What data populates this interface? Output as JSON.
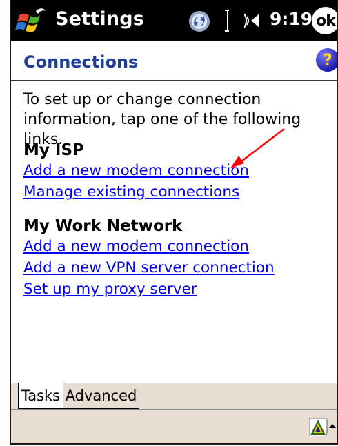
{
  "titlebar": {
    "title": "Settings",
    "clock": "9:19",
    "ok_label": "ok"
  },
  "header": {
    "page_title": "Connections",
    "help_glyph": "?"
  },
  "body": {
    "intro": "To set up or change connection information, tap one of the following links.",
    "sections": [
      {
        "heading": "My ISP",
        "links": [
          "Add a new modem connection",
          "Manage existing connections"
        ]
      },
      {
        "heading": "My Work Network",
        "links": [
          "Add a new modem connection",
          "Add a new VPN server connection",
          "Set up my proxy server"
        ]
      }
    ]
  },
  "tabs": [
    "Tasks",
    "Advanced"
  ],
  "icons": {
    "start": "windows-flag-icon",
    "sync": "activesync-icon",
    "signal": "signal-icon",
    "volume": "speaker-icon",
    "help": "help-icon",
    "sip": "input-panel-icon",
    "sip_arrow": "up-arrow-icon",
    "annotation": "red-arrow-icon"
  },
  "colors": {
    "title_bar": "#000000",
    "header_text": "#1f3f9a",
    "link": "#0000ee",
    "tab_bar": "#e7ddd3",
    "annotation_arrow": "#ff0000"
  }
}
